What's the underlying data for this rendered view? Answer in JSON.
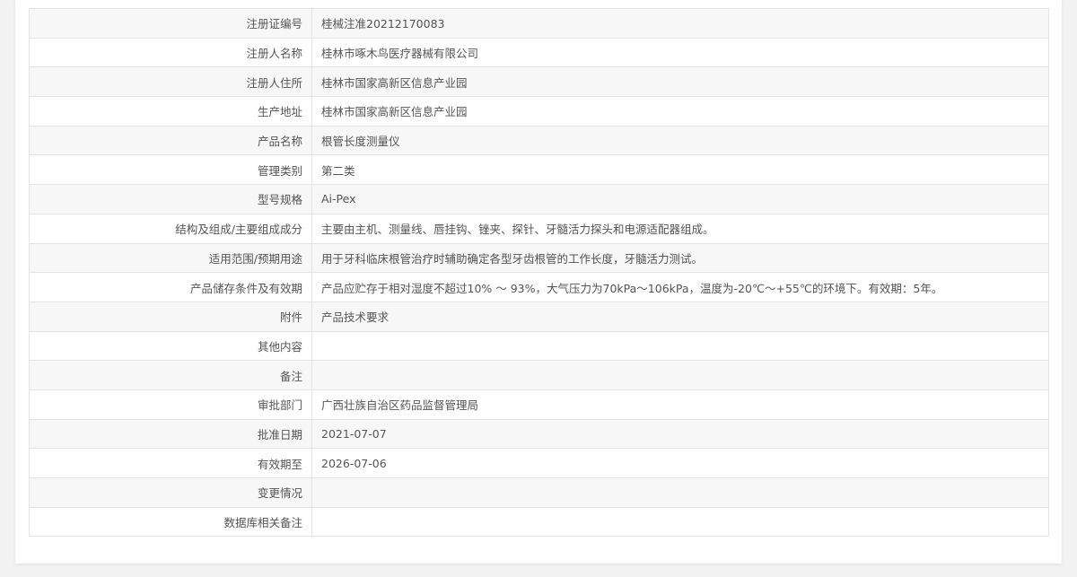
{
  "rows": [
    {
      "label": "注册证编号",
      "value": "桂械注准20212170083"
    },
    {
      "label": "注册人名称",
      "value": "桂林市啄木鸟医疗器械有限公司"
    },
    {
      "label": "注册人住所",
      "value": "桂林市国家高新区信息产业园"
    },
    {
      "label": "生产地址",
      "value": "桂林市国家高新区信息产业园"
    },
    {
      "label": "产品名称",
      "value": "根管长度测量仪"
    },
    {
      "label": "管理类别",
      "value": "第二类"
    },
    {
      "label": "型号规格",
      "value": "Ai-Pex"
    },
    {
      "label": "结构及组成/主要组成成分",
      "value": "主要由主机、测量线、唇挂钩、锉夹、探针、牙髓活力探头和电源适配器组成。"
    },
    {
      "label": "适用范围/预期用途",
      "value": "用于牙科临床根管治疗时辅助确定各型牙齿根管的工作长度，牙髓活力测试。"
    },
    {
      "label": "产品储存条件及有效期",
      "value": "产品应贮存于相对湿度不超过10% ～ 93%，大气压力为70kPa～106kPa，温度为-20℃～+55℃的环境下。有效期：5年。"
    },
    {
      "label": "附件",
      "value": "产品技术要求"
    },
    {
      "label": "其他内容",
      "value": ""
    },
    {
      "label": "备注",
      "value": ""
    },
    {
      "label": "审批部门",
      "value": "广西壮族自治区药品监督管理局"
    },
    {
      "label": "批准日期",
      "value": "2021-07-07"
    },
    {
      "label": "有效期至",
      "value": "2026-07-06"
    },
    {
      "label": "变更情况",
      "value": ""
    },
    {
      "label": "数据库相关备注",
      "value": ""
    }
  ]
}
